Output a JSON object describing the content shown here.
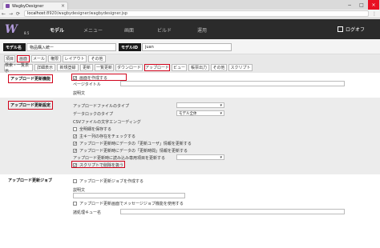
{
  "browser": {
    "tab_title": "WagbyDesigner",
    "url_host": "localhost",
    "url_rest": ":8920/wagbydesigner/wagbydesigner.jsp"
  },
  "app": {
    "logo_text": "W",
    "version": "8.5",
    "nav": [
      "モデル",
      "メニュー",
      "画面",
      "ビルド",
      "運用"
    ],
    "logout": "ログオフ"
  },
  "model": {
    "name_label": "モデル名",
    "name_value": "物品購入統ー",
    "id_label": "モデルID",
    "id_value": "juan"
  },
  "tabs_top": [
    "項目",
    "画面",
    "メール",
    "権限",
    "レイアウト",
    "その他"
  ],
  "tabs_sub": [
    "検索・一覧表示",
    "詳細表示",
    "新規登録",
    "更新",
    "一覧更新",
    "ダウンロード",
    "アップロード",
    "ビュー",
    "帳票出力",
    "その他",
    "スクリプト"
  ],
  "sections": {
    "update": {
      "title": "アップロード更新機能",
      "create_screen": "画面を作成する",
      "page_title_label": "ページタイトル",
      "desc_label": "説明文"
    },
    "settings": {
      "title": "アップロード更新設定",
      "file_type": "アップロードファイルのタイプ",
      "lock_type": "データロックのタイプ",
      "lock_value": "モデル全体",
      "csv_encoding": "CSVファイルの文字エンコーディング",
      "save_history": "全明細を保存する",
      "check_count": "主キー列の存在をチェックする",
      "update_user_info": "アップロード更新時にデータの「更新ユーザ」情報を更新する",
      "update_time_info": "アップロード更新時にデータの「更新時間」情報を更新する",
      "target_table": "アップロード更新時に読み込み専用項目を更新する",
      "script_label": "スクリプトで削除を扱う"
    },
    "job": {
      "title": "アップロード更新ジョブ",
      "create_job": "アップロード更新ジョブを作成する",
      "desc_label": "説明文",
      "queue_msg": "アップロード更新画面でメッセージジョブ機能を使用する",
      "queue_name": "諸処理キュー名"
    }
  }
}
